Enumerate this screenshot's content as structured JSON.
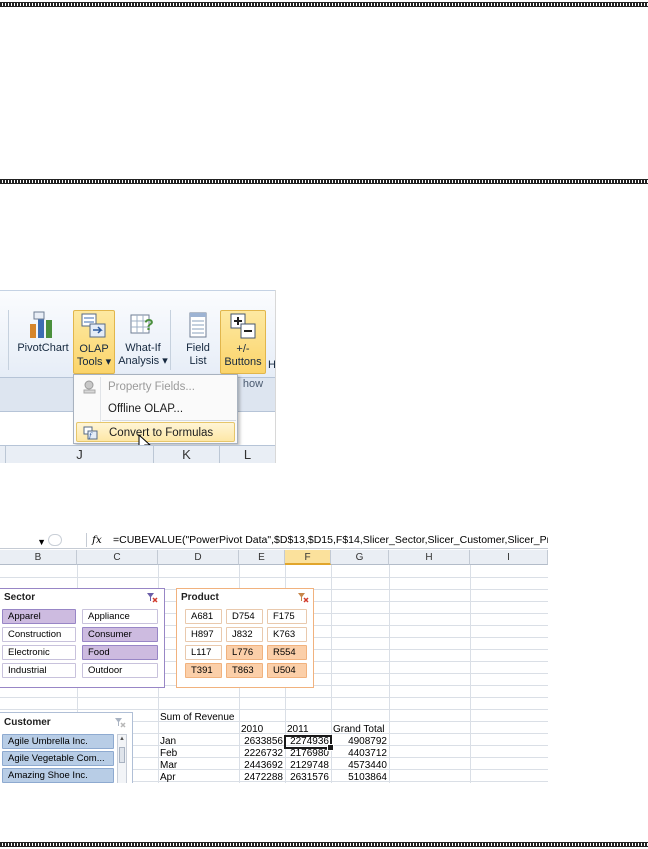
{
  "ribbon": {
    "buttons": [
      {
        "label1": "PivotChart",
        "label2": ""
      },
      {
        "label1": "OLAP",
        "label2": "Tools ▾"
      },
      {
        "label1": "What-If",
        "label2": "Analysis ▾"
      },
      {
        "label1": "Field",
        "label2": "List"
      },
      {
        "label1": "+/-",
        "label2": "Buttons"
      }
    ],
    "cut_label": "H",
    "group_label": "how",
    "menu": [
      {
        "label": "Property Fields...",
        "state": "disabled",
        "icon": "property-fields-icon"
      },
      {
        "label": "Offline OLAP...",
        "state": "normal",
        "icon": ""
      },
      {
        "label": "Convert to Formulas",
        "state": "hover",
        "icon": "convert-formulas-icon"
      }
    ],
    "columns": [
      "J",
      "K",
      "L"
    ]
  },
  "sheet": {
    "fx": "fx",
    "formula": "=CUBEVALUE(\"PowerPivot Data\",$D$13,$D15,F$14,Slicer_Sector,Slicer_Customer,Slicer_Product)",
    "columns": [
      "B",
      "C",
      "D",
      "E",
      "F",
      "G",
      "H",
      "I"
    ],
    "selected_column": "F",
    "sector_slicer": {
      "title": "Sector",
      "items": [
        {
          "label": "Apparel",
          "selected": true
        },
        {
          "label": "Appliance",
          "selected": false
        },
        {
          "label": "Construction",
          "selected": false
        },
        {
          "label": "Consumer",
          "selected": true
        },
        {
          "label": "Electronic",
          "selected": false
        },
        {
          "label": "Food",
          "selected": true
        },
        {
          "label": "Industrial",
          "selected": false
        },
        {
          "label": "Outdoor",
          "selected": false
        }
      ]
    },
    "product_slicer": {
      "title": "Product",
      "items": [
        {
          "label": "A681",
          "selected": false
        },
        {
          "label": "D754",
          "selected": false
        },
        {
          "label": "F175",
          "selected": false
        },
        {
          "label": "H897",
          "selected": false
        },
        {
          "label": "J832",
          "selected": false
        },
        {
          "label": "K763",
          "selected": false
        },
        {
          "label": "L117",
          "selected": false
        },
        {
          "label": "L776",
          "selected": true
        },
        {
          "label": "R554",
          "selected": true
        },
        {
          "label": "T391",
          "selected": true
        },
        {
          "label": "T863",
          "selected": true
        },
        {
          "label": "U504",
          "selected": true
        }
      ]
    },
    "customer_slicer": {
      "title": "Customer",
      "items": [
        "Agile Umbrella Inc.",
        "Agile Vegetable Com...",
        "Amazing Shoe Inc."
      ]
    },
    "pivot": {
      "header": "Sum of Revenue",
      "col_headers": [
        "2010",
        "2011",
        "Grand Total"
      ],
      "rows": [
        {
          "label": "Jan",
          "values": [
            "2633856",
            "2274936",
            "4908792"
          ]
        },
        {
          "label": "Feb",
          "values": [
            "2226732",
            "2176980",
            "4403712"
          ]
        },
        {
          "label": "Mar",
          "values": [
            "2443692",
            "2129748",
            "4573440"
          ]
        },
        {
          "label": "Apr",
          "values": [
            "2472288",
            "2631576",
            "5103864"
          ]
        }
      ]
    },
    "colors": {
      "sector_selected": "#cdbbe0",
      "sector_border": "#9886c6",
      "product_selected": "#fbcfa9",
      "product_border": "#f1b27e",
      "customer_selected": "#b8cde6",
      "customer_border": "#8eaad0"
    }
  }
}
